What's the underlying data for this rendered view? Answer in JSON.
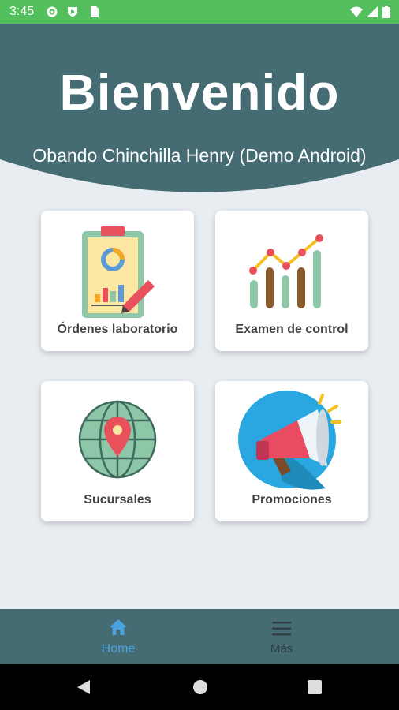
{
  "status_bar": {
    "time": "3:45"
  },
  "header": {
    "title": "Bienvenido",
    "user": "Obando Chinchilla Henry (Demo Android)"
  },
  "cards": [
    {
      "label": "Órdenes laboratorio",
      "icon": "clipboard-chart-icon"
    },
    {
      "label": "Examen de control",
      "icon": "bar-line-chart-icon"
    },
    {
      "label": "Sucursales",
      "icon": "globe-location-icon"
    },
    {
      "label": "Promociones",
      "icon": "megaphone-icon"
    }
  ],
  "bottom_nav": {
    "items": [
      {
        "label": "Home",
        "icon": "home-icon",
        "active": true
      },
      {
        "label": "Más",
        "icon": "menu-icon",
        "active": false
      }
    ]
  },
  "colors": {
    "status": "#53c05d",
    "header": "#456b73",
    "active": "#4aa3df",
    "inactive": "#2f3f44"
  }
}
